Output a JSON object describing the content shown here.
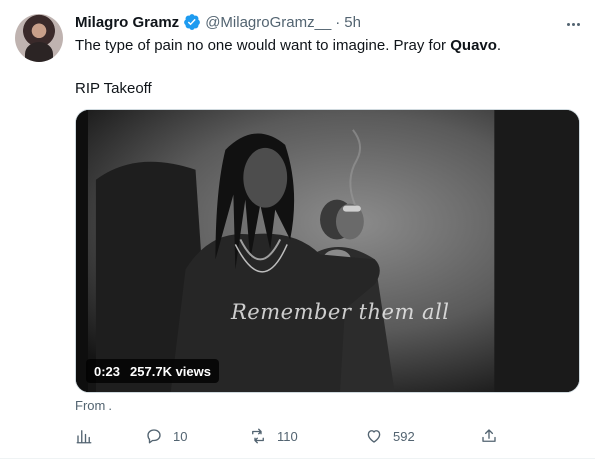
{
  "tweet": {
    "author_name": "Milagro Gramz",
    "handle": "@MilagroGramz__",
    "separator": "·",
    "time": "5h",
    "text_before_bold": "The type of pain no one would want to imagine. Pray for ",
    "text_bold": "Quavo",
    "text_after_bold": ".",
    "text_line2": "RIP Takeoff",
    "verified_icon": "verified-badge-icon",
    "more_icon": "more-options-icon"
  },
  "video": {
    "caption": "Remember them all",
    "time": "0:23",
    "views": "257.7K views"
  },
  "source": {
    "label": "From",
    "value": "."
  },
  "actions": {
    "analytics_icon": "analytics-icon",
    "reply_count": "10",
    "retweet_count": "110",
    "like_count": "592",
    "share_icon": "share-icon"
  },
  "colors": {
    "text_primary": "#0f1419",
    "text_secondary": "#536471",
    "verified": "#1d9bf0",
    "border": "#eff3f4"
  }
}
